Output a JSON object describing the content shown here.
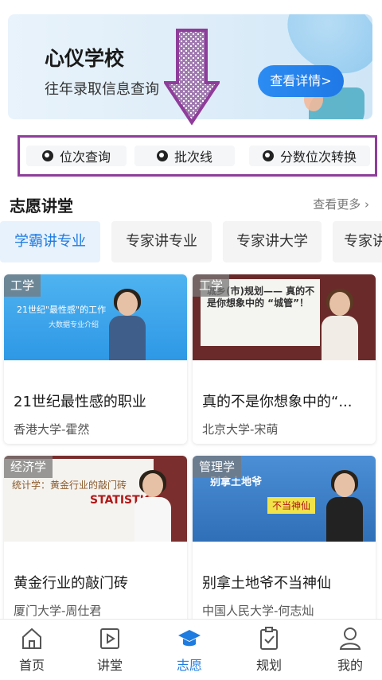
{
  "banner": {
    "title": "心仪学校",
    "subtitle": "往年录取信息查询",
    "button": "查看详情>"
  },
  "tools": [
    {
      "label": "位次查询",
      "icon": "search-icon"
    },
    {
      "label": "批次线",
      "icon": "bars-icon"
    },
    {
      "label": "分数位次转换",
      "icon": "swap-icon"
    }
  ],
  "section": {
    "title": "志愿讲堂",
    "more": "查看更多 ›"
  },
  "tabs": [
    "学霸讲专业",
    "专家讲专业",
    "专家讲大学",
    "专家讲"
  ],
  "cards": [
    {
      "tag": "工学",
      "title": "21世纪最性感的职业",
      "source": "香港大学-霍然",
      "screen_text": "21世纪\"最性感\"的工作",
      "screen_sub": "大数据专业介绍"
    },
    {
      "tag": "工学",
      "title": "真的不是你想象中的“...",
      "source": "北京大学-宋萌",
      "screen_text": "城乡(市)规划—— 真的不是你想象中的 “城管”！"
    },
    {
      "tag": "经济学",
      "title": "黄金行业的敲门砖",
      "source": "厦门大学-周仕君",
      "screen_text": "统计学：黄金行业的敲门砖",
      "screen_sub": "STATISTICS"
    },
    {
      "tag": "管理学",
      "title": "别拿土地爷不当神仙",
      "source": "中国人民大学-何志灿",
      "screen_text": "别拿土地爷",
      "screen_sub": "不当神仙"
    }
  ],
  "nav": [
    {
      "label": "首页",
      "icon": "home-icon"
    },
    {
      "label": "讲堂",
      "icon": "video-icon"
    },
    {
      "label": "志愿",
      "icon": "graduation-cap-icon",
      "active": true
    },
    {
      "label": "规划",
      "icon": "clipboard-icon"
    },
    {
      "label": "我的",
      "icon": "user-icon"
    }
  ],
  "colors": {
    "accent": "#1e7be0",
    "highlight_border": "#8f3d9a"
  }
}
